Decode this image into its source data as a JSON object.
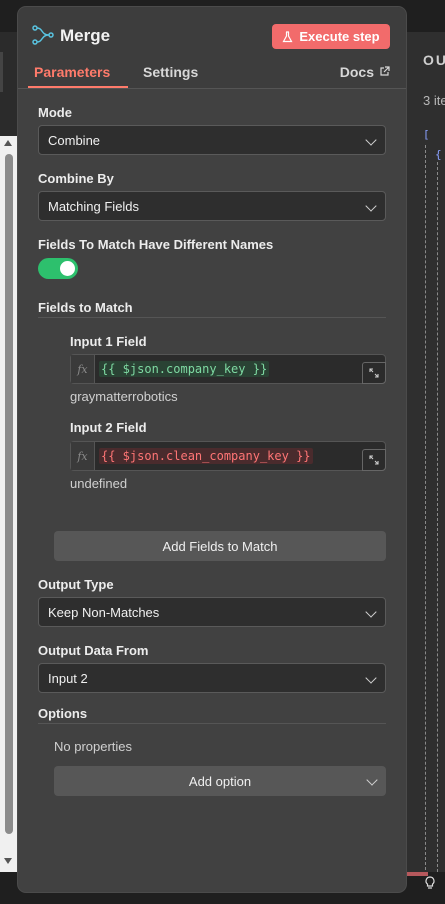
{
  "background": {
    "output_label": "OU",
    "output_count": "3 ite",
    "json_open_bracket": "[",
    "json_open_brace": "{"
  },
  "node": {
    "title": "Merge",
    "execute_label": "Execute step",
    "accent_color": "#f26b6b"
  },
  "tabs": {
    "parameters": "Parameters",
    "settings": "Settings",
    "docs": "Docs"
  },
  "form": {
    "mode": {
      "label": "Mode",
      "value": "Combine"
    },
    "combine_by": {
      "label": "Combine By",
      "value": "Matching Fields"
    },
    "different_names": {
      "label": "Fields To Match Have Different Names",
      "enabled": true
    },
    "fields_to_match": {
      "section_label": "Fields to Match",
      "input1": {
        "label": "Input 1 Field",
        "expression": "{{ $json.company_key }}",
        "resolved": "graymatterrobotics",
        "fx": "fx"
      },
      "input2": {
        "label": "Input 2 Field",
        "expression": "{{ $json.clean_company_key }}",
        "resolved": "undefined",
        "fx": "fx"
      },
      "add_button": "Add Fields to Match"
    },
    "output_type": {
      "label": "Output Type",
      "value": "Keep Non-Matches"
    },
    "output_data_from": {
      "label": "Output Data From",
      "value": "Input 2"
    },
    "options": {
      "section_label": "Options",
      "empty_text": "No properties",
      "add_button": "Add option"
    }
  }
}
